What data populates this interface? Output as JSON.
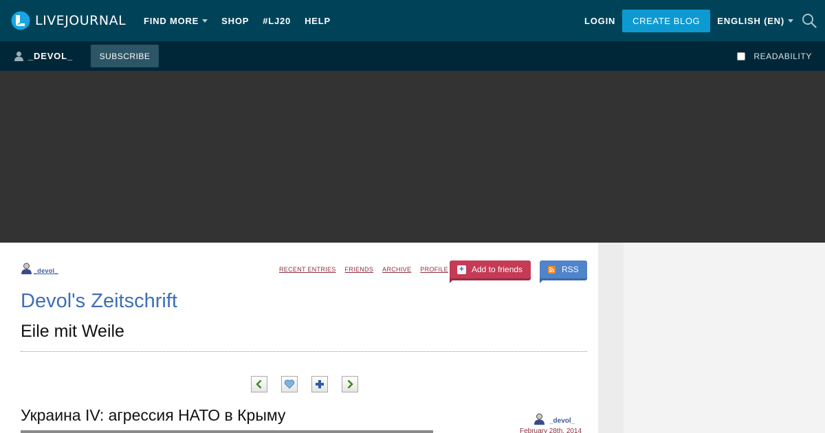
{
  "header": {
    "logo_text": "LIVEJOURNAL",
    "nav": [
      {
        "label": "FIND MORE",
        "has_dropdown": true
      },
      {
        "label": "SHOP",
        "has_dropdown": false
      },
      {
        "label": "#LJ20",
        "has_dropdown": false
      },
      {
        "label": "HELP",
        "has_dropdown": false
      }
    ],
    "login_label": "LOGIN",
    "create_blog_label": "CREATE BLOG",
    "language_label": "ENGLISH (EN)",
    "search_icon": "search-icon"
  },
  "subheader": {
    "username": "_DEVOL_",
    "subscribe_label": "SUBSCRIBE",
    "readability_label": "READABILITY",
    "readability_checked": false
  },
  "journal": {
    "owner": "_devol_",
    "links": [
      "RECENT ENTRIES",
      "FRIENDS",
      "ARCHIVE",
      "PROFILE"
    ],
    "add_friends_label": "Add to friends",
    "rss_label": "RSS",
    "title": "Devol's Zeitschrift",
    "subtitle": "Eile mit Weile"
  },
  "entry": {
    "nav_icons": [
      "prev-arrow-icon",
      "heart-icon",
      "plus-icon",
      "next-arrow-icon"
    ],
    "title": "Украина IV: агрессия НАТО в Крыму",
    "author": "_devol_",
    "date": "February 28th, 2014"
  },
  "colors": {
    "topbar": "#004359",
    "subbar": "#002738",
    "accent": "#0d9ad2",
    "journal_title": "#3d6fb5",
    "link": "#8b2d3b",
    "add_friends": "#c53a55",
    "rss": "#4f84cb"
  }
}
